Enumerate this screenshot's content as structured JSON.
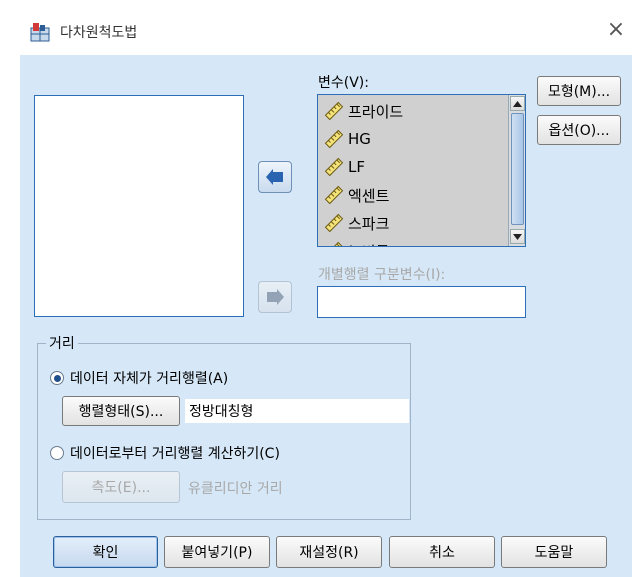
{
  "window": {
    "title": "다차원척도법"
  },
  "variables": {
    "label": "변수(V):",
    "items": [
      "프라이드",
      "HG",
      "LF",
      "엑센트",
      "스파크",
      "뉴비틀"
    ]
  },
  "side_buttons": {
    "model": "모형(M)...",
    "options": "옵션(O)..."
  },
  "individual_matrix": {
    "label": "개별행렬 구분변수(I):",
    "value": ""
  },
  "distance": {
    "group_title": "거리",
    "radio_data_is_distance": "데이터 자체가 거리행렬(A)",
    "radio_data_is_distance_checked": true,
    "shape_button": "행렬형태(S)...",
    "shape_value": "정방대칭형",
    "radio_create_from_data": "데이터로부터 거리행렬 계산하기(C)",
    "radio_create_from_data_checked": false,
    "measure_button": "측도(E)...",
    "measure_value": "유클리디안 거리"
  },
  "footer": {
    "ok": "확인",
    "paste": "붙여넣기(P)",
    "reset": "재설정(R)",
    "cancel": "취소",
    "help": "도움말"
  },
  "colors": {
    "background": "#d6e8f7",
    "accent": "#2d6fb7",
    "disabled_text": "#a8a8a8"
  }
}
